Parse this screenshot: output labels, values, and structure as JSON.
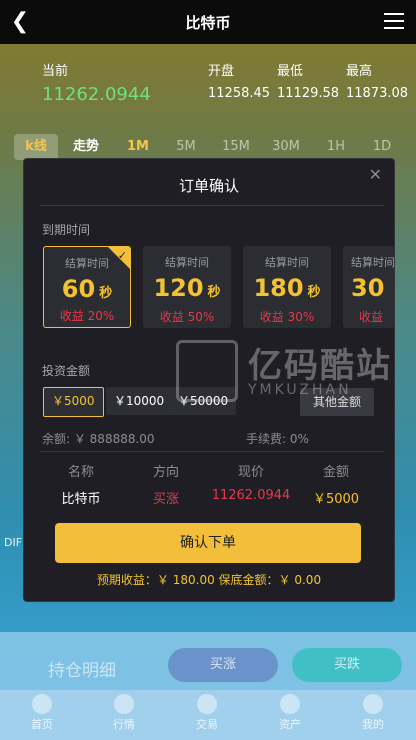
{
  "header": {
    "title": "比特币"
  },
  "quote": {
    "current_label": "当前",
    "current_value": "11262.0944",
    "open_label": "开盘",
    "open_value": "11258.45",
    "low_label": "最低",
    "low_value": "11129.58",
    "high_label": "最高",
    "high_value": "11873.08"
  },
  "tabs": [
    "k线",
    "走势",
    "1M",
    "5M",
    "15M",
    "30M",
    "1H",
    "1D"
  ],
  "side_text": "DIF",
  "modal": {
    "title": "订单确认",
    "expiry_label": "到期时间",
    "cards": [
      {
        "caption": "结算时间",
        "number": "60",
        "unit": "秒",
        "income": "收益 20%"
      },
      {
        "caption": "结算时间",
        "number": "120",
        "unit": "秒",
        "income": "收益 50%"
      },
      {
        "caption": "结算时间",
        "number": "180",
        "unit": "秒",
        "income": "收益 30%"
      },
      {
        "caption": "结算时间",
        "number": "30",
        "unit": "",
        "income": "收益"
      }
    ],
    "invest_label": "投资金额",
    "amounts": [
      "￥5000",
      "￥10000",
      "￥50000"
    ],
    "other_amount": "其他金额",
    "balance": "余额: ￥ 888888.00",
    "fee": "手续费: 0%",
    "table_headers": [
      "名称",
      "方向",
      "现价",
      "金额"
    ],
    "table_values": [
      "比特币",
      "买涨",
      "11262.0944",
      "￥5000"
    ],
    "confirm_label": "确认下单",
    "footer": "预期收益：￥ 180.00   保底金额：￥ 0.00"
  },
  "watermark": {
    "big": "亿码酷站",
    "small": "YMKUZHAN"
  },
  "bottom": {
    "hold_label": "持仓明细",
    "buy_up": "买涨",
    "buy_down": "买跌"
  },
  "tabbar": [
    "首页",
    "行情",
    "交易",
    "资产",
    "我的"
  ]
}
